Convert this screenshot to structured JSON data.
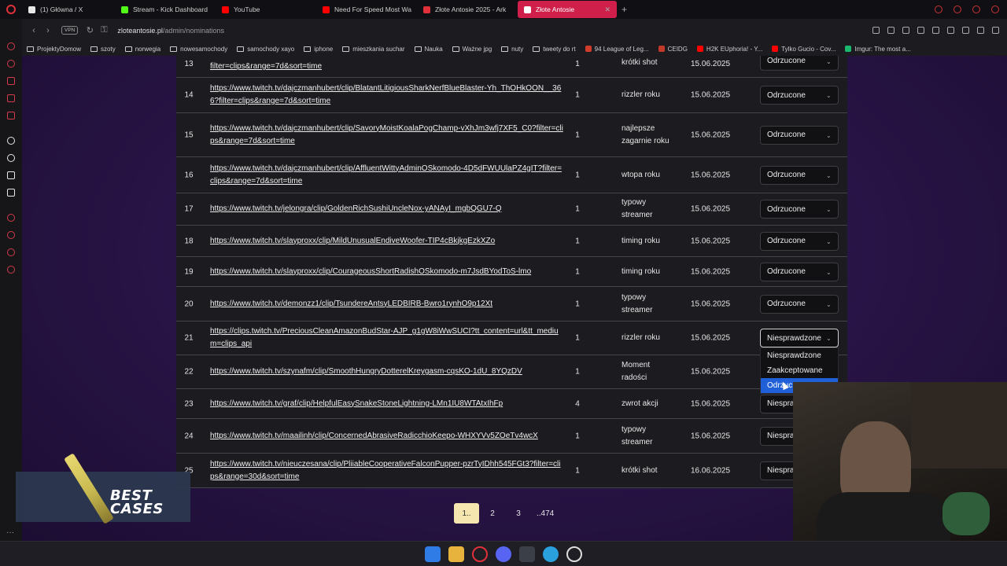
{
  "browser": {
    "tabs": [
      {
        "label": "(1) Główna / X",
        "color": "#e8e8e8"
      },
      {
        "label": "Stream - Kick Dashboard",
        "color": "#53fc18"
      },
      {
        "label": "YouTube",
        "color": "#ff0000"
      },
      {
        "label": "Need For Speed Most Wa",
        "color": "#ff0000"
      },
      {
        "label": "Złote Antosie 2025 - Ark",
        "color": "#e0313b"
      },
      {
        "label": "Złote Antosie",
        "color": "#e0313b",
        "active": true
      }
    ],
    "new_tab": "+",
    "vpn": "VPN",
    "url_domain": "zloteantosie.pl",
    "url_path": "/admin/nominations",
    "bookmarks": [
      {
        "label": "ProjektyDomow",
        "type": "folder"
      },
      {
        "label": "szoty",
        "type": "folder"
      },
      {
        "label": "norwegia",
        "type": "folder"
      },
      {
        "label": "nowesamochody",
        "type": "folder"
      },
      {
        "label": "samochody xayo",
        "type": "folder"
      },
      {
        "label": "iphone",
        "type": "folder"
      },
      {
        "label": "mieszkania suchar",
        "type": "folder"
      },
      {
        "label": "Nauka",
        "type": "folder"
      },
      {
        "label": "Ważne jpg",
        "type": "folder"
      },
      {
        "label": "nuty",
        "type": "folder"
      },
      {
        "label": "tweety do rt",
        "type": "folder"
      },
      {
        "label": "94 League of Leg...",
        "type": "site",
        "color": "#d13b2a"
      },
      {
        "label": "CEIDG",
        "type": "site",
        "color": "#c0392b"
      },
      {
        "label": "H2K EUphoria! - Y...",
        "type": "site",
        "color": "#ff0000"
      },
      {
        "label": "Tylko Gucio - Cov...",
        "type": "site",
        "color": "#ff0000"
      },
      {
        "label": "Imgur: The most a...",
        "type": "site",
        "color": "#1bb76e"
      }
    ]
  },
  "nominations": [
    {
      "id": "13",
      "link": "filter=clips&range=7d&sort=time",
      "count": "1",
      "category": "krótki shot",
      "date": "15.06.2025",
      "status": "Odrzucone"
    },
    {
      "id": "14",
      "link": "https://www.twitch.tv/dajczmanhubert/clip/BlatantLitigiousSharkNerfBlueBlaster-Yh_ThOHkOON__366?filter=clips&range=7d&sort=time",
      "count": "1",
      "category": "rizzler roku",
      "date": "15.06.2025",
      "status": "Odrzucone"
    },
    {
      "id": "15",
      "link": "https://www.twitch.tv/dajczmanhubert/clip/SavoryMoistKoalaPogChamp-vXhJm3wfj7XF5_C0?filter=clips&range=7d&sort=time",
      "count": "1",
      "category": "najlepsze zagarnie roku",
      "date": "15.06.2025",
      "status": "Odrzucone"
    },
    {
      "id": "16",
      "link": "https://www.twitch.tv/dajczmanhubert/clip/AffluentWittyAdminOSkomodo-4D5dFWUUlaPZ4gIT?filter=clips&range=7d&sort=time",
      "count": "1",
      "category": "wtopa roku",
      "date": "15.06.2025",
      "status": "Odrzucone"
    },
    {
      "id": "17",
      "link": "https://www.twitch.tv/jelongra/clip/GoldenRichSushiUncleNox-yANAyI_mgbQGU7-Q",
      "count": "1",
      "category": "typowy streamer",
      "date": "15.06.2025",
      "status": "Odrzucone"
    },
    {
      "id": "18",
      "link": "https://www.twitch.tv/slayproxx/clip/MildUnusualEndiveWoofer-TIP4cBkjkgEzkXZo",
      "count": "1",
      "category": "timing roku",
      "date": "15.06.2025",
      "status": "Odrzucone"
    },
    {
      "id": "19",
      "link": "https://www.twitch.tv/slayproxx/clip/CourageousShortRadishOSkomodo-m7JsdBYodToS-lmo",
      "count": "1",
      "category": "timing roku",
      "date": "15.06.2025",
      "status": "Odrzucone"
    },
    {
      "id": "20",
      "link": "https://www.twitch.tv/demonzz1/clip/TsundereAntsyLEDBIRB-Bwro1rynhO9p12Xt",
      "count": "1",
      "category": "typowy streamer",
      "date": "15.06.2025",
      "status": "Odrzucone"
    },
    {
      "id": "21",
      "link": "https://clips.twitch.tv/PreciousCleanAmazonBudStar-AJP_g1gW8iWwSUCI?tt_content=url&tt_medium=clips_api",
      "count": "1",
      "category": "rizzler roku",
      "date": "15.06.2025",
      "status": "Niesprawdzone",
      "open": true
    },
    {
      "id": "22",
      "link": "https://www.twitch.tv/szynafm/clip/SmoothHungryDotterelKreygasm-cqsKO-1dU_8YQzDV",
      "count": "1",
      "category": "Moment radości",
      "date": "15.06.2025",
      "status": ""
    },
    {
      "id": "23",
      "link": "https://www.twitch.tv/graf/clip/HelpfulEasySnakeStoneLightning-LMn1IU8WTAtxIhFp",
      "count": "4",
      "category": "zwrot akcji",
      "date": "15.06.2025",
      "status": "Niespra"
    },
    {
      "id": "24",
      "link": "https://www.twitch.tv/maailinh/clip/ConcernedAbrasiveRadicchioKeepo-WHXYVv5ZOeTv4wcX",
      "count": "1",
      "category": "typowy streamer",
      "date": "15.06.2025",
      "status": "Niespra"
    },
    {
      "id": "25",
      "link": "https://www.twitch.tv/nieuczesana/clip/PliiableCooperativeFalconPupper-pzrTyIDhh545FGt3?filter=clips&range=30d&sort=time",
      "count": "1",
      "category": "krótki shot",
      "date": "16.06.2025",
      "status": "Niespra"
    }
  ],
  "status_dropdown": {
    "options": [
      "Niesprawdzone",
      "Zaakceptowane",
      "Odrzuc"
    ],
    "highlighted": "Odrzuc"
  },
  "pagination": {
    "pages": [
      "1..",
      "2",
      "3",
      "..474"
    ],
    "active": "1.."
  },
  "promo": {
    "text_line1": "BEST",
    "text_line2": "CASES"
  },
  "colors": {
    "accent": "#cf1f4a",
    "highlight": "#1f5fd8",
    "page_active": "#f5e6b0"
  }
}
